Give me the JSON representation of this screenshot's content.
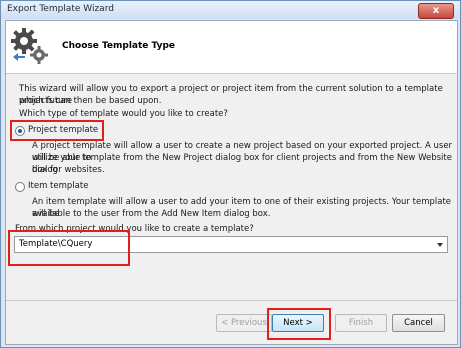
{
  "window": {
    "title": "Export Template Wizard",
    "close_label": "x"
  },
  "header": {
    "title": "Choose Template Type",
    "icon": "gears-icon"
  },
  "intro": {
    "line1": "This wizard will allow you to export a project or project item from the current solution to a template which future",
    "line2": "projects can then be based upon.",
    "question": "Which type of template would you like to create?"
  },
  "options": {
    "project": {
      "label": "Project template",
      "selected": true,
      "desc1": "A project template will allow a user to create a new project based on your exported project. A user will be able to",
      "desc2": "utilize your template from the New Project dialog box for client projects and from the New Website dialog",
      "desc3": "box for websites."
    },
    "item": {
      "label": "Item template",
      "selected": false,
      "desc1": "An item template will allow a user to add your item to one of their existing projects. Your template will be",
      "desc2": "available to the user from the Add New Item dialog box."
    }
  },
  "source": {
    "question": "From which project would you like to create a template?",
    "value": "Template\\CQuery"
  },
  "buttons": {
    "previous": "< Previous",
    "next": "Next >",
    "finish": "Finish",
    "cancel": "Cancel"
  },
  "colors": {
    "highlight": "#e0201a"
  }
}
